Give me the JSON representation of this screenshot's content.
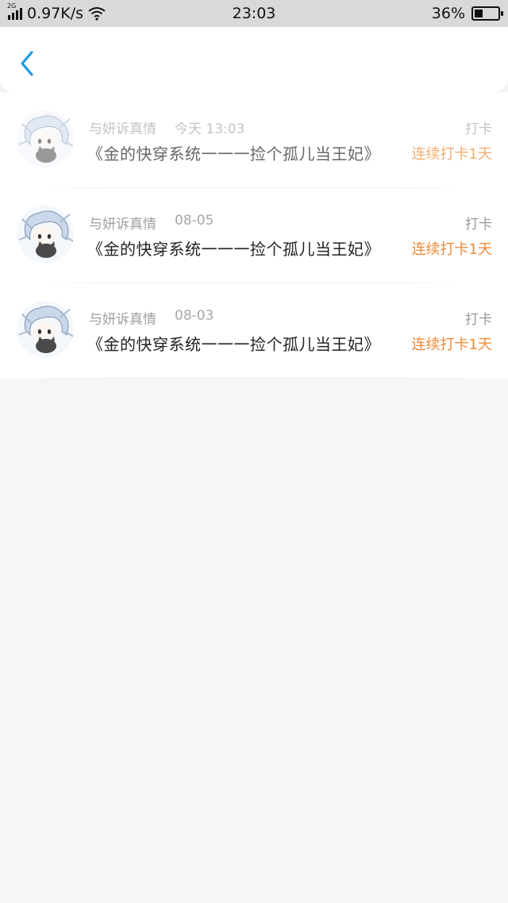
{
  "status_bar": {
    "network_type": "2G",
    "speed": "0.97K/s",
    "time": "23:03",
    "battery": "36%",
    "battery_level": 0.36,
    "signal_icon": "signal-icon",
    "wifi_icon": "wifi-icon",
    "battery_icon": "battery-icon"
  },
  "header": {
    "back_icon": "chevron-left-icon",
    "accent_color": "#1d9be6"
  },
  "records": [
    {
      "user": "与妍诉真情",
      "time": "今天 13:03",
      "title": "《金的快穿系统一一一捡个孤儿当王妃》",
      "action": "打卡",
      "streak": "连续打卡1天"
    },
    {
      "user": "与妍诉真情",
      "time": "08-05",
      "title": "《金的快穿系统一一一捡个孤儿当王妃》",
      "action": "打卡",
      "streak": "连续打卡1天"
    },
    {
      "user": "与妍诉真情",
      "time": "08-03",
      "title": "《金的快穿系统一一一捡个孤儿当王妃》",
      "action": "打卡",
      "streak": "连续打卡1天"
    }
  ],
  "colors": {
    "streak": "#ec8a3a",
    "background": "#f6f6f6"
  }
}
